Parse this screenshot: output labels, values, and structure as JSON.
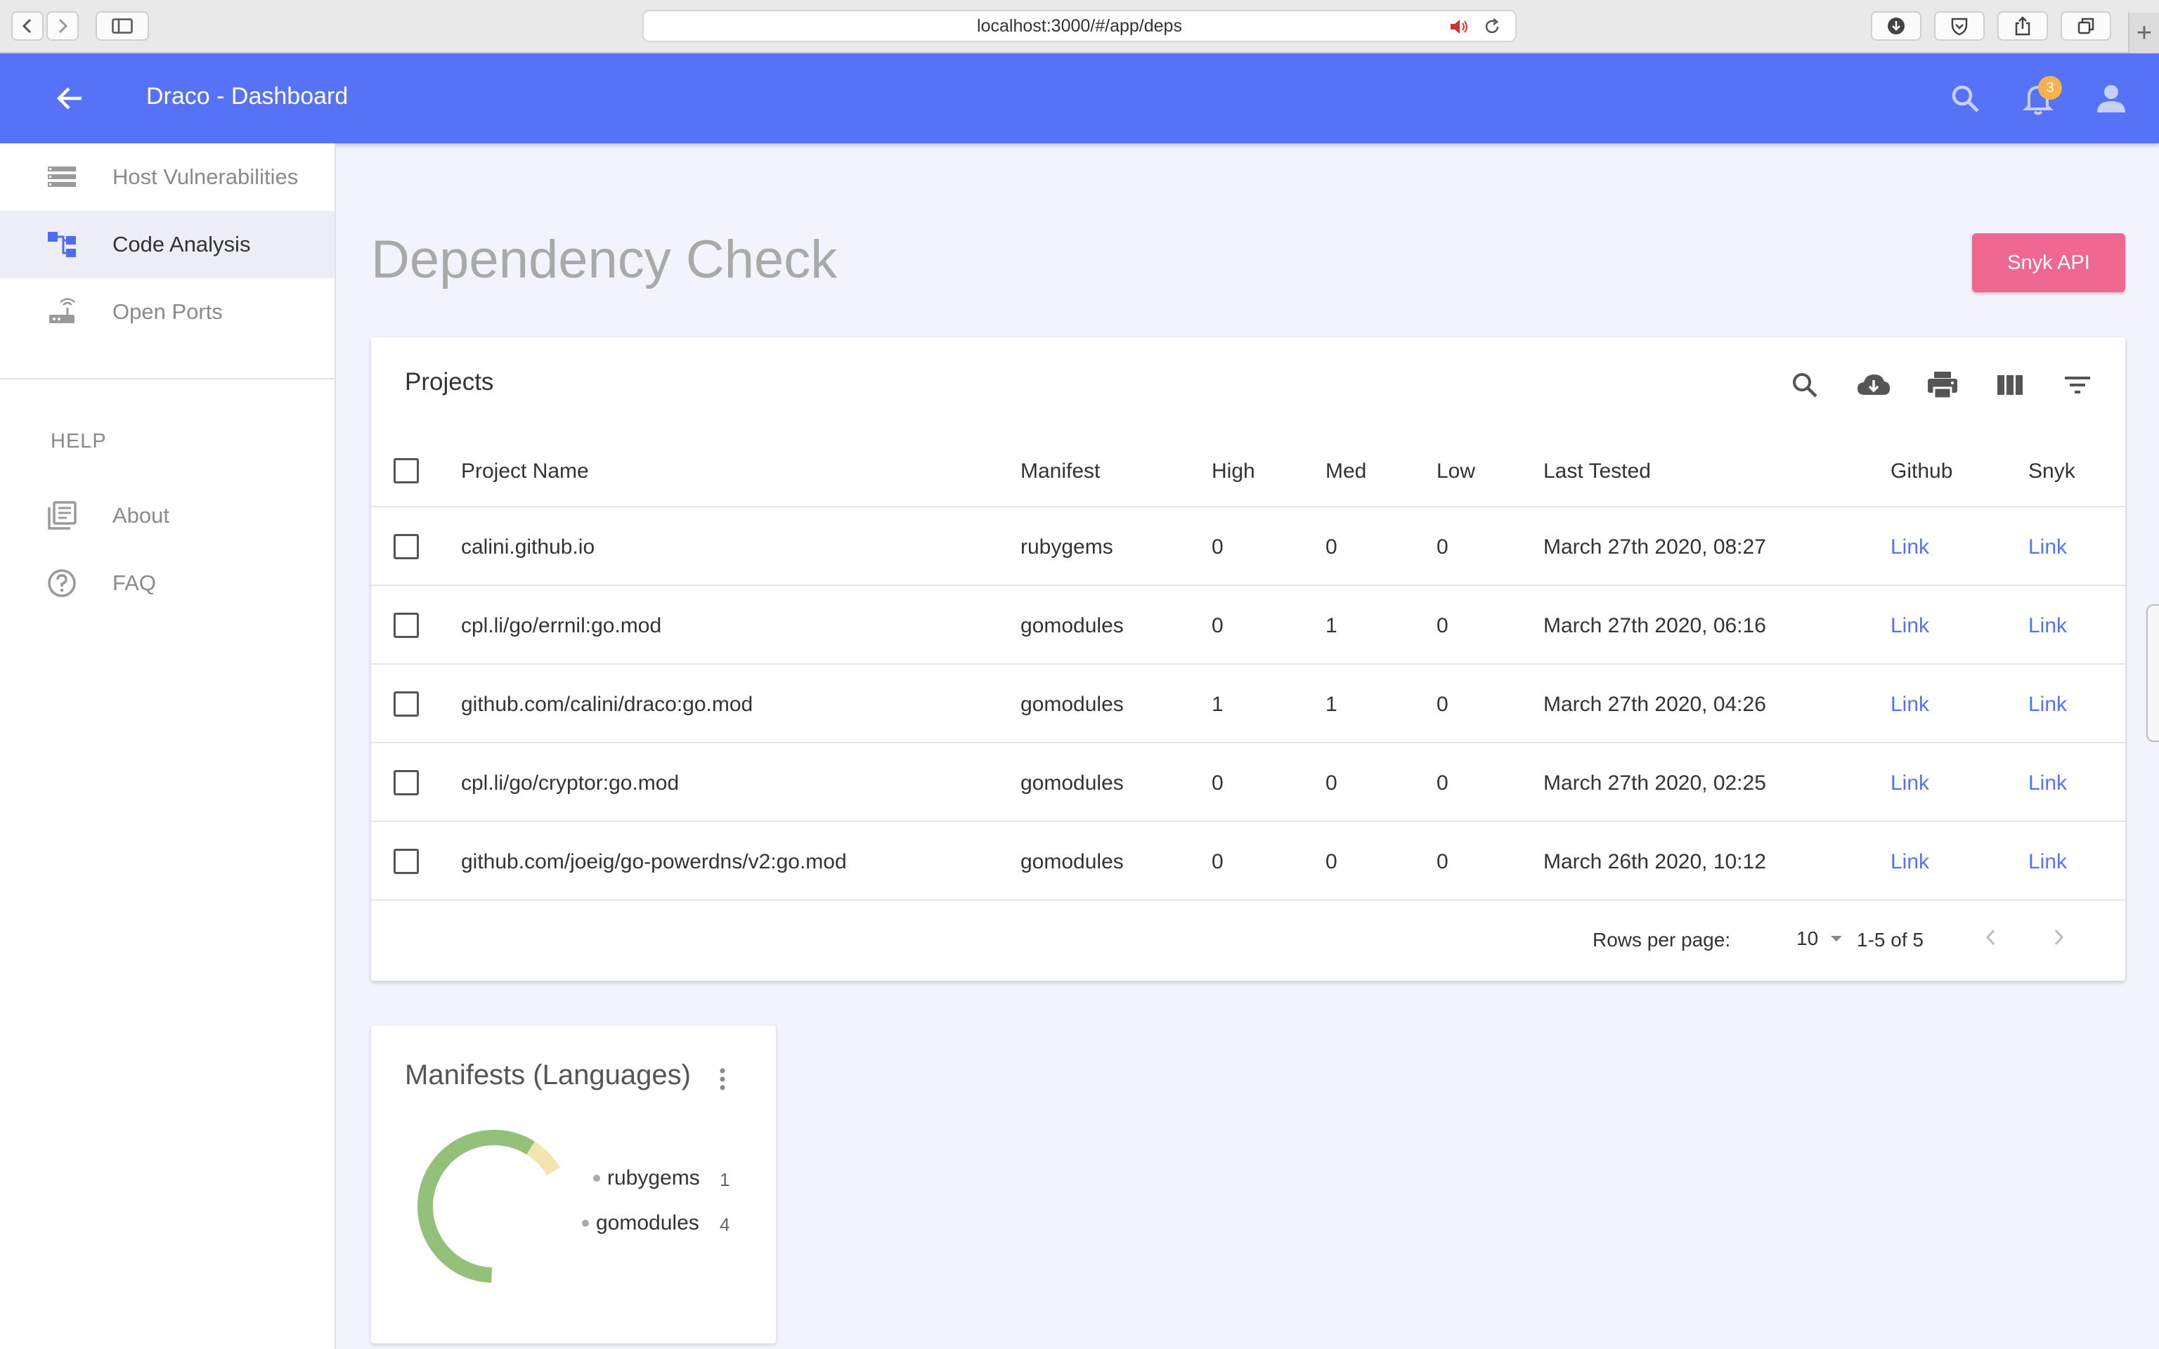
{
  "browser": {
    "url": "localhost:3000/#/app/deps"
  },
  "appbar": {
    "title": "Draco - Dashboard",
    "notification_count": "3"
  },
  "sidebar": {
    "items": [
      {
        "label": "Host Vulnerabilities",
        "icon": "list-icon"
      },
      {
        "label": "Code Analysis",
        "icon": "hierarchy-icon"
      },
      {
        "label": "Open Ports",
        "icon": "router-icon"
      }
    ],
    "help_heading": "HELP",
    "help_items": [
      {
        "label": "About",
        "icon": "library-books-icon"
      },
      {
        "label": "FAQ",
        "icon": "help-circle-icon"
      }
    ]
  },
  "page": {
    "title": "Dependency Check",
    "snyk_button": "Snyk API"
  },
  "projects": {
    "title": "Projects",
    "columns": [
      "Project Name",
      "Manifest",
      "High",
      "Med",
      "Low",
      "Last Tested",
      "Github",
      "Snyk"
    ],
    "rows": [
      {
        "name": "calini.github.io",
        "manifest": "rubygems",
        "high": "0",
        "med": "0",
        "low": "0",
        "tested": "March 27th 2020, 08:27",
        "github": "Link",
        "snyk": "Link"
      },
      {
        "name": "cpl.li/go/errnil:go.mod",
        "manifest": "gomodules",
        "high": "0",
        "med": "1",
        "low": "0",
        "tested": "March 27th 2020, 06:16",
        "github": "Link",
        "snyk": "Link"
      },
      {
        "name": "github.com/calini/draco:go.mod",
        "manifest": "gomodules",
        "high": "1",
        "med": "1",
        "low": "0",
        "tested": "March 27th 2020, 04:26",
        "github": "Link",
        "snyk": "Link"
      },
      {
        "name": "cpl.li/go/cryptor:go.mod",
        "manifest": "gomodules",
        "high": "0",
        "med": "0",
        "low": "0",
        "tested": "March 27th 2020, 02:25",
        "github": "Link",
        "snyk": "Link"
      },
      {
        "name": "github.com/joeig/go-powerdns/v2:go.mod",
        "manifest": "gomodules",
        "high": "0",
        "med": "0",
        "low": "0",
        "tested": "March 26th 2020, 10:12",
        "github": "Link",
        "snyk": "Link"
      }
    ],
    "footer": {
      "rows_per_page_label": "Rows per page:",
      "rows_per_page_value": "10",
      "range": "1-5 of 5"
    }
  },
  "manifests": {
    "title": "Manifests (Languages)",
    "legend": [
      {
        "name": "rubygems",
        "count": "1",
        "color": "#f1e6b2"
      },
      {
        "name": "gomodules",
        "count": "4",
        "color": "#93c17a"
      }
    ]
  },
  "colors": {
    "appbar": "#5672f6",
    "accent_button": "#ef6891",
    "link": "#5672f6"
  }
}
